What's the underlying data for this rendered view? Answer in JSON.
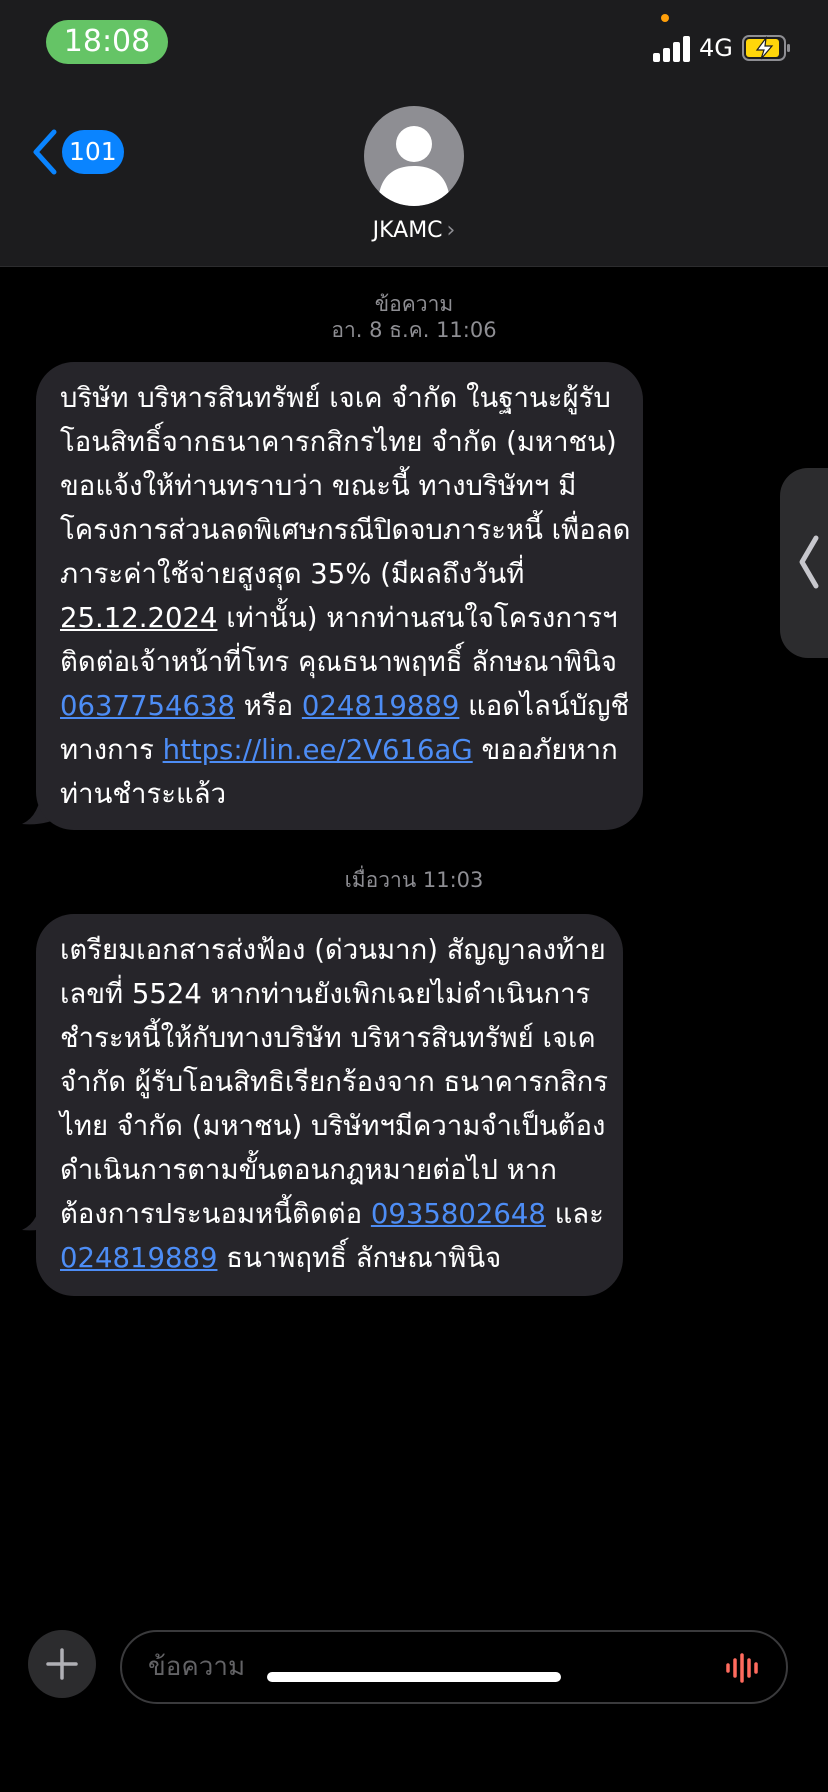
{
  "status_bar": {
    "time": "18:08",
    "network": "4G"
  },
  "header": {
    "back_count": "101",
    "contact_name": "JKAMC",
    "contact_chevron": "›"
  },
  "thread": [
    {
      "timestamp_label": "ข้อความ",
      "timestamp": "อา. 8 ธ.ค. 11:06",
      "lines": [
        [
          {
            "t": "บริษัท บริหารสินทรัพย์ เจเค จำกัด ในฐานะผู้รับ"
          }
        ],
        [
          {
            "t": "โอนสิทธิ์จากธนาคารกสิกรไทย จำกัด (มหาชน)"
          }
        ],
        [
          {
            "t": "ขอแจ้งให้ท่านทราบว่า ขณะนี้ ทางบริษัทฯ มี"
          }
        ],
        [
          {
            "t": "โครงการส่วนลดพิเศษกรณีปิดจบภาระหนี้ เพื่อลด"
          }
        ],
        [
          {
            "t": "ภาระค่าใช้จ่ายสูงสุด 35% (มีผลถึงวันที่"
          }
        ],
        [
          {
            "t": "25.12.2024",
            "k": "u"
          },
          {
            "t": " เท่านั้น) หากท่านสนใจโครงการฯ"
          }
        ],
        [
          {
            "t": "ติดต่อเจ้าหน้าที่โทร คุณธนาพฤทธิ์ ลักษณาพินิจ"
          }
        ],
        [
          {
            "t": "0637754638",
            "k": "link"
          },
          {
            "t": " หรือ "
          },
          {
            "t": "024819889",
            "k": "link"
          },
          {
            "t": " แอดไลน์บัญชี"
          }
        ],
        [
          {
            "t": "ทางการ "
          },
          {
            "t": "https://lin.ee/2V616aG",
            "k": "link"
          },
          {
            "t": " ขออภัยหาก"
          }
        ],
        [
          {
            "t": "ท่านชำระแล้ว"
          }
        ]
      ]
    },
    {
      "timestamp_label": "",
      "timestamp": "เมื่อวาน 11:03",
      "lines": [
        [
          {
            "t": "เตรียมเอกสารส่งฟ้อง (ด่วนมาก) สัญญาลงท้าย"
          }
        ],
        [
          {
            "t": "เลขที่ 5524 หากท่านยังเพิกเฉยไม่ดำเนินการ"
          }
        ],
        [
          {
            "t": "ชำระหนี้ให้กับทางบริษัท บริหารสินทรัพย์ เจเค"
          }
        ],
        [
          {
            "t": "จำกัด ผู้รับโอนสิทธิเรียกร้องจาก ธนาคารกสิกร"
          }
        ],
        [
          {
            "t": "ไทย จำกัด (มหาชน) บริษัทฯมีความจำเป็นต้อง"
          }
        ],
        [
          {
            "t": "ดำเนินการตามขั้นตอนกฎหมายต่อไป หาก"
          }
        ],
        [
          {
            "t": "ต้องการประนอมหนี้ติดต่อ "
          },
          {
            "t": "0935802648",
            "k": "link"
          },
          {
            "t": " และ"
          }
        ],
        [
          {
            "t": "024819889",
            "k": "link"
          },
          {
            "t": "  ธนาพฤทธิ์ ลักษณาพินิจ"
          }
        ]
      ]
    }
  ],
  "composer": {
    "placeholder": "ข้อความ"
  },
  "icons": {
    "back": "chevron-left-icon",
    "avatar": "person-icon",
    "side": "chevron-left-icon",
    "plus": "plus-icon",
    "mic": "waveform-icon",
    "battery": "battery-charging-icon"
  },
  "colors": {
    "accent": "#0a84ff",
    "link": "#4d8df5",
    "bubble": "#26252a",
    "time_pill": "#65c466",
    "waveform": "#ff6b5e",
    "battery_fill": "#ffd60a"
  }
}
